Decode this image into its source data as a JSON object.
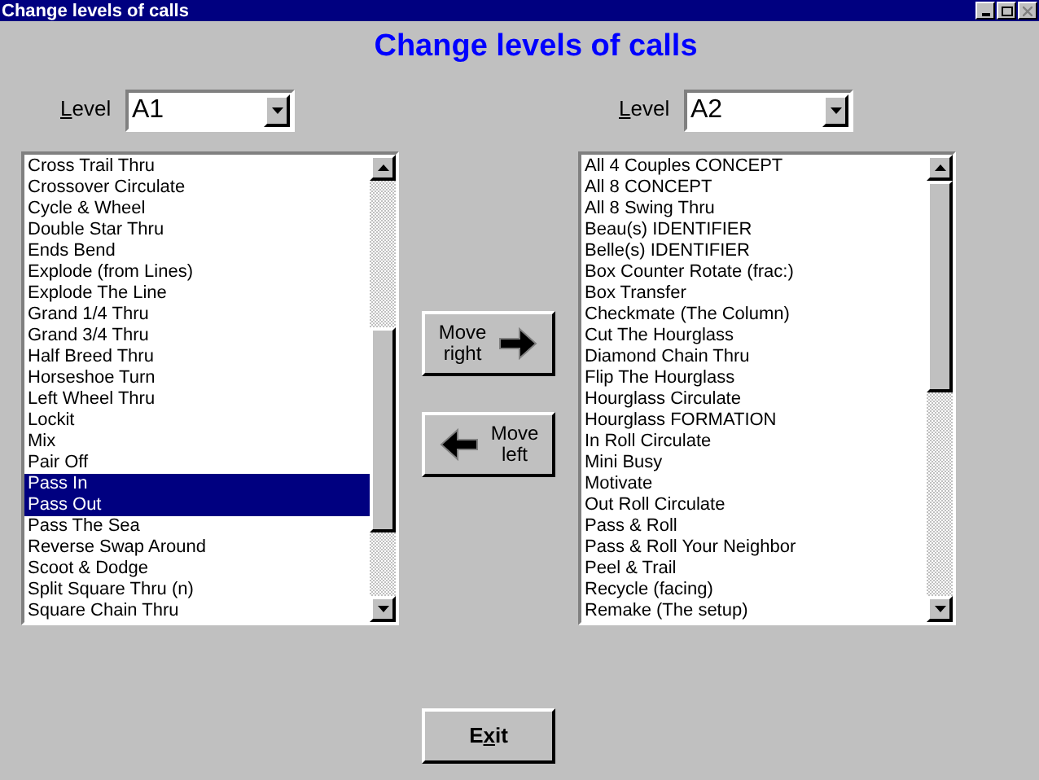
{
  "window": {
    "title": "Change levels of calls"
  },
  "heading": "Change levels of calls",
  "left": {
    "level_label": {
      "key": "L",
      "after": "evel"
    },
    "level_value": "A1",
    "items": [
      {
        "label": "Cross Trail Thru",
        "selected": false
      },
      {
        "label": "Crossover Circulate",
        "selected": false
      },
      {
        "label": "Cycle & Wheel",
        "selected": false
      },
      {
        "label": "Double Star Thru",
        "selected": false
      },
      {
        "label": "Ends Bend",
        "selected": false
      },
      {
        "label": "Explode (from Lines)",
        "selected": false
      },
      {
        "label": "Explode The Line",
        "selected": false
      },
      {
        "label": "Grand 1/4 Thru",
        "selected": false
      },
      {
        "label": "Grand 3/4 Thru",
        "selected": false
      },
      {
        "label": "Half Breed Thru",
        "selected": false
      },
      {
        "label": "Horseshoe Turn",
        "selected": false
      },
      {
        "label": "Left Wheel Thru",
        "selected": false
      },
      {
        "label": "Lockit",
        "selected": false
      },
      {
        "label": "Mix",
        "selected": false
      },
      {
        "label": "Pair Off",
        "selected": false
      },
      {
        "label": "Pass In",
        "selected": true
      },
      {
        "label": "Pass Out",
        "selected": true
      },
      {
        "label": "Pass The Sea",
        "selected": false
      },
      {
        "label": "Reverse Swap Around",
        "selected": false
      },
      {
        "label": "Scoot & Dodge",
        "selected": false
      },
      {
        "label": "Split Square Thru (n)",
        "selected": false
      },
      {
        "label": "Square Chain Thru",
        "selected": false
      }
    ]
  },
  "right": {
    "level_label": {
      "key": "L",
      "after": "evel"
    },
    "level_value": "A2",
    "items": [
      {
        "label": "All 4 Couples CONCEPT",
        "selected": false
      },
      {
        "label": "All 8 CONCEPT",
        "selected": false
      },
      {
        "label": "All 8 Swing Thru",
        "selected": false
      },
      {
        "label": "Beau(s) IDENTIFIER",
        "selected": false
      },
      {
        "label": "Belle(s) IDENTIFIER",
        "selected": false
      },
      {
        "label": "Box Counter Rotate (frac:)",
        "selected": false
      },
      {
        "label": "Box Transfer",
        "selected": false
      },
      {
        "label": "Checkmate (The Column)",
        "selected": false
      },
      {
        "label": "Cut The Hourglass",
        "selected": false
      },
      {
        "label": "Diamond Chain Thru",
        "selected": false
      },
      {
        "label": "Flip The Hourglass",
        "selected": false
      },
      {
        "label": "Hourglass Circulate",
        "selected": false
      },
      {
        "label": "Hourglass FORMATION",
        "selected": false
      },
      {
        "label": "In Roll Circulate",
        "selected": false
      },
      {
        "label": "Mini Busy",
        "selected": false
      },
      {
        "label": "Motivate",
        "selected": false
      },
      {
        "label": "Out Roll Circulate",
        "selected": false
      },
      {
        "label": "Pass & Roll",
        "selected": false
      },
      {
        "label": "Pass & Roll Your Neighbor",
        "selected": false
      },
      {
        "label": "Peel & Trail",
        "selected": false
      },
      {
        "label": "Recycle (facing)",
        "selected": false
      },
      {
        "label": "Remake (The setup)",
        "selected": false
      }
    ]
  },
  "move_buttons": [
    {
      "kind": "right",
      "line1": "Move",
      "line2": "right"
    },
    {
      "kind": "left",
      "line1": "Move",
      "line2": "left"
    }
  ],
  "exit_button": {
    "before": "E",
    "key": "x",
    "after": "it"
  }
}
